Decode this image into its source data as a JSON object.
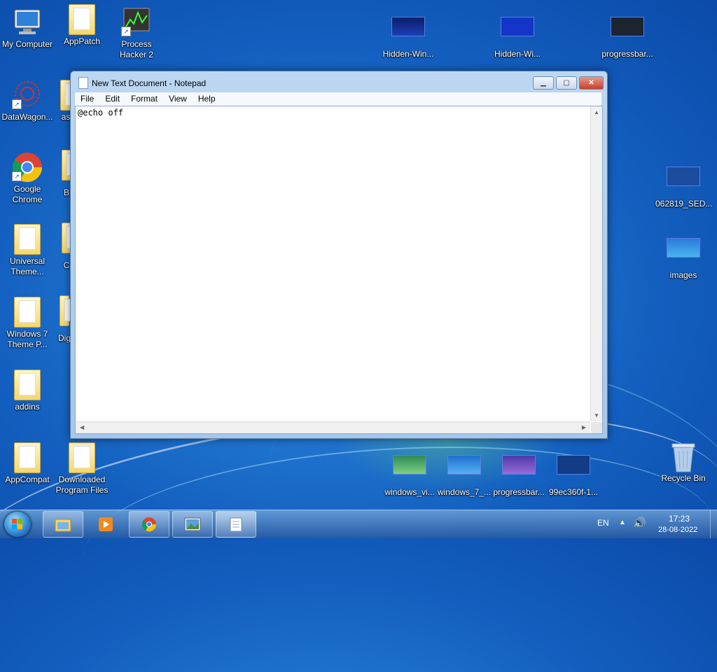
{
  "desktop_icons": [
    {
      "label": "My Computer"
    },
    {
      "label": "AppPatch"
    },
    {
      "label": "Process Hacker 2"
    },
    {
      "label": "Hidden-Win..."
    },
    {
      "label": "Hidden-Wi..."
    },
    {
      "label": "progressbar..."
    },
    {
      "label": "DataWagon..."
    },
    {
      "label": "as"
    },
    {
      "label": "Google Chrome"
    },
    {
      "label": "B"
    },
    {
      "label": "062819_SED..."
    },
    {
      "label": "Universal Theme..."
    },
    {
      "label": "C"
    },
    {
      "label": "images"
    },
    {
      "label": "Windows 7 Theme P..."
    },
    {
      "label": "Dig"
    },
    {
      "label": "addins"
    },
    {
      "label": "AppCompat"
    },
    {
      "label": "Downloaded Program Files"
    },
    {
      "label": "windows_vi..."
    },
    {
      "label": "windows_7_..."
    },
    {
      "label": "progressbar..."
    },
    {
      "label": "99ec360f-1..."
    },
    {
      "label": "Recycle Bin"
    }
  ],
  "notepad": {
    "title": "New Text Document - Notepad",
    "buttons": {
      "minimize": "▁",
      "maximize": "▢",
      "close": "✕"
    },
    "menu": [
      "File",
      "Edit",
      "Format",
      "View",
      "Help"
    ],
    "content": "@echo off"
  },
  "taskbar": {
    "pinned": [
      "explorer",
      "media-player",
      "chrome",
      "photo-viewer",
      "notepad"
    ],
    "language": "EN",
    "time": "17:23",
    "date": "28-08-2022"
  }
}
